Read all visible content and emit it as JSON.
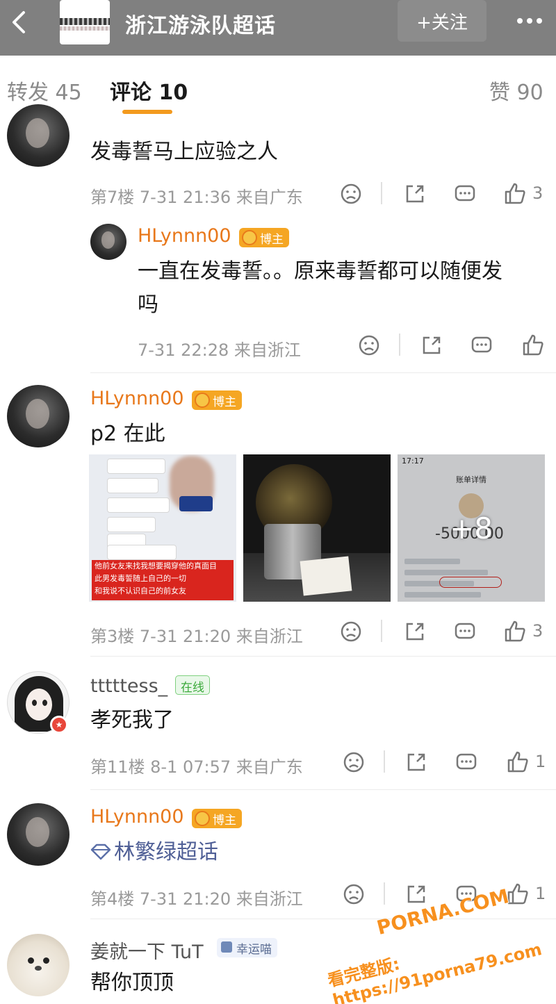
{
  "header": {
    "title": "浙江游泳队超话",
    "follow_label": "+关注",
    "back_icon": "chevron-left-icon",
    "more_icon": "more-icon",
    "bg_color": "#808080"
  },
  "tabs": [
    {
      "label": "转发 45"
    },
    {
      "label": "评论 10",
      "active": true
    },
    {
      "label": "赞 90"
    }
  ],
  "accent_color": "#f39a1e",
  "comments": [
    {
      "user": "",
      "text": "发毒誓马上应验之人",
      "meta": "第7楼  7-31 21:36  来自广东",
      "likes": "3",
      "reply": {
        "user": "HLynnn00",
        "badge": "博主",
        "text_line1": "一直在发毒誓。。原来毒誓都可以随便发",
        "text_line2": "吗",
        "meta": "7-31 22:28  来自浙江"
      }
    },
    {
      "user": "HLynnn00",
      "badge": "博主",
      "text": "p2 在此",
      "images": {
        "pic1_caption_line1": "他前女友来找我想要揭穿他的真面目",
        "pic1_caption_line2": "此男发毒誓随上自己的一切",
        "pic1_caption_line3": "和我说不认识自己的前女友",
        "more_count": "+8",
        "pic3_time": "17:17",
        "pic3_header": "账单详情",
        "pic3_amount": "-5000.00"
      },
      "meta": "第3楼  7-31 21:20  来自浙江",
      "likes": "3"
    },
    {
      "user": "tttttess_",
      "badge": "在线",
      "text": "孝死我了",
      "meta": "第11楼  8-1 07:57  来自广东",
      "likes": "1"
    },
    {
      "user": "HLynnn00",
      "badge": "博主",
      "text": "林繁绿超话",
      "meta": "第4楼  7-31 21:20  来自浙江",
      "likes": "1"
    },
    {
      "user": "姜就一下 TuT",
      "badge": "幸运喵",
      "text": "帮你顶顶"
    }
  ],
  "watermark": {
    "line1": "PORNA.COM",
    "line2": "看完整版: https://91porna79.com"
  }
}
